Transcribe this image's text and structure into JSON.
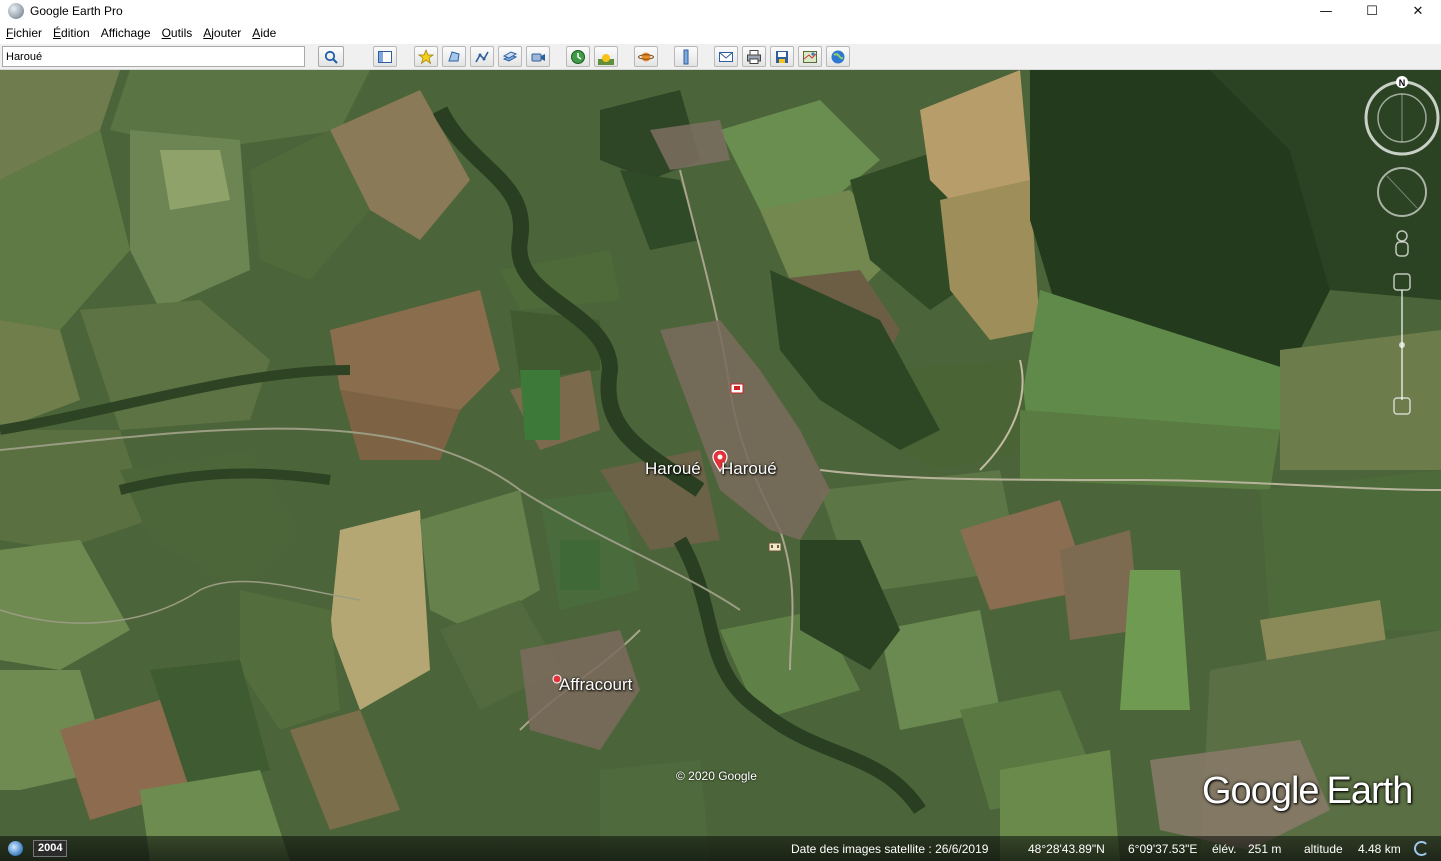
{
  "window": {
    "title": "Google Earth Pro",
    "minimize": "—",
    "maximize": "☐",
    "close": "✕"
  },
  "menu": [
    {
      "accel": "F",
      "rest": "ichier"
    },
    {
      "accel": "É",
      "rest": "dition"
    },
    {
      "accel": "",
      "rest": "Affichage"
    },
    {
      "accel": "O",
      "rest": "utils"
    },
    {
      "accel": "A",
      "rest": "jouter"
    },
    {
      "accel": "A",
      "rest": "ide"
    }
  ],
  "search": {
    "value": "Haroué"
  },
  "toolbar": {
    "icons": [
      "sidebar-icon",
      "placemark-icon",
      "polygon-icon",
      "path-icon",
      "overlay-icon",
      "tour-icon",
      "historical-imagery-icon",
      "sunlight-icon",
      "planets-icon",
      "ruler-icon",
      "email-icon",
      "print-icon",
      "save-image-icon",
      "view-in-maps-icon",
      "web-icon"
    ]
  },
  "map": {
    "labels": {
      "haroue_1": "Haroué",
      "haroue_2": "Haroué",
      "affracourt": "Affracourt"
    },
    "copyright": "© 2020 Google",
    "logo_google": "Google",
    "logo_earth": "Earth",
    "north": "N"
  },
  "status": {
    "year": "2004",
    "imagery_date": "Date des images satellite : 26/6/2019",
    "lat": "48°28'43.89\"N",
    "lon": "6°09'37.53\"E",
    "elev_label": "élév.",
    "elev_value": "251 m",
    "alt_label": "altitude",
    "alt_value": "4.48 km"
  },
  "colors": {
    "toolbar_bg": "#f0f0f0",
    "pin_red": "#e2333a",
    "forest": "#2c3f22"
  }
}
